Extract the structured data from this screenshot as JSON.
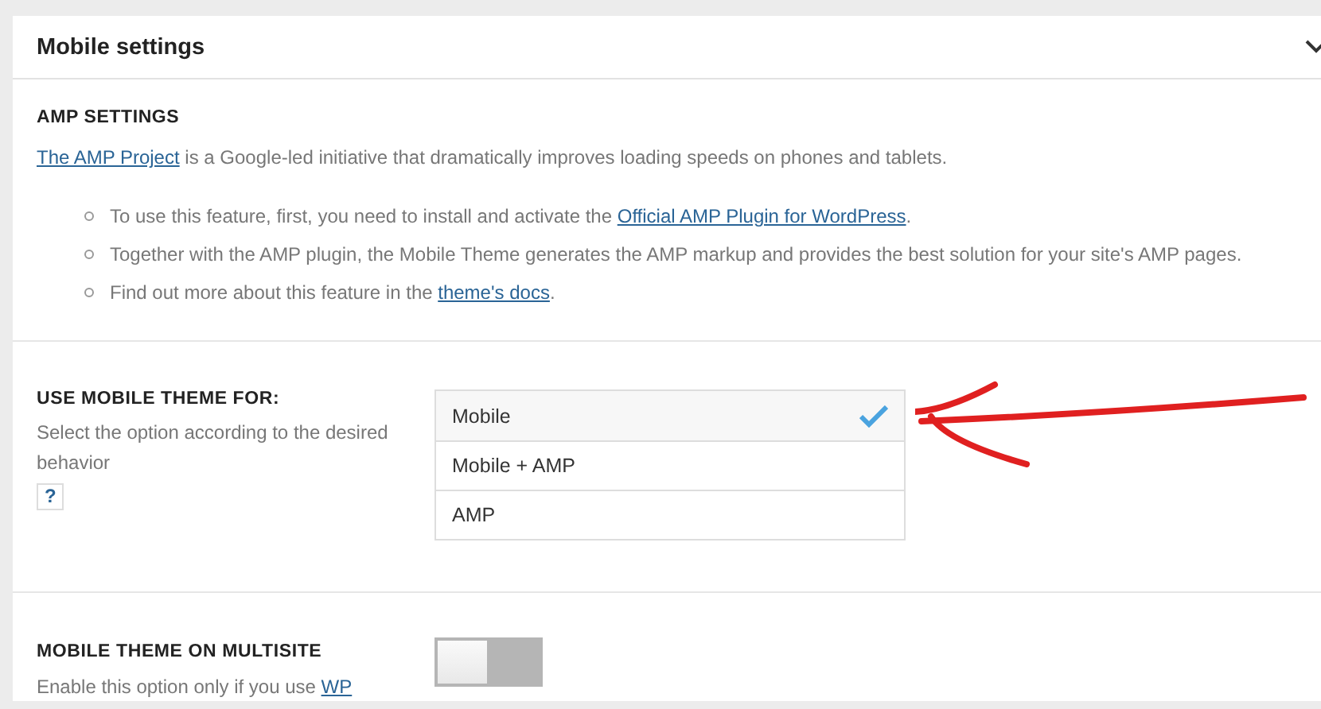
{
  "panel": {
    "title": "Mobile settings",
    "expanded": true
  },
  "amp": {
    "heading": "AMP SETTINGS",
    "intro": [
      {
        "text": "The AMP Project",
        "link": true
      },
      {
        "text": " is a Google-led initiative that dramatically improves loading speeds on phones and tablets.",
        "link": false
      }
    ],
    "bullets": [
      [
        {
          "text": "To use this feature, first, you need to install and activate the ",
          "link": false
        },
        {
          "text": "Official AMP Plugin for WordPress",
          "link": true
        },
        {
          "text": ".",
          "link": false
        }
      ],
      [
        {
          "text": "Together with the AMP plugin, the Mobile Theme generates the AMP markup and provides the best solution for your site's AMP pages.",
          "link": false
        }
      ],
      [
        {
          "text": "Find out more about this feature in the ",
          "link": false
        },
        {
          "text": "theme's docs",
          "link": true
        },
        {
          "text": ".",
          "link": false
        }
      ]
    ]
  },
  "use_for": {
    "heading": "USE MOBILE THEME FOR:",
    "description": "Select the option according to the desired behavior",
    "help": "?",
    "options": [
      {
        "label": "Mobile",
        "selected": true
      },
      {
        "label": "Mobile + AMP",
        "selected": false
      },
      {
        "label": "AMP",
        "selected": false
      }
    ]
  },
  "multisite": {
    "heading": "MOBILE THEME ON MULTISITE",
    "description": [
      {
        "text": "Enable this option only if you use ",
        "link": false
      },
      {
        "text": "WP",
        "link": true
      }
    ],
    "on": false
  }
}
